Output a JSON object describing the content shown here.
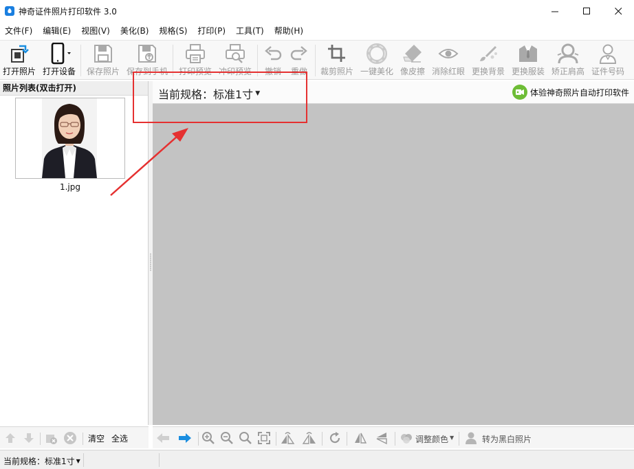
{
  "window": {
    "title": "神奇证件照片打印软件 3.0"
  },
  "menu": [
    {
      "label": "文件(F)"
    },
    {
      "label": "编辑(E)"
    },
    {
      "label": "视图(V)"
    },
    {
      "label": "美化(B)"
    },
    {
      "label": "规格(S)"
    },
    {
      "label": "打印(P)"
    },
    {
      "label": "工具(T)"
    },
    {
      "label": "帮助(H)"
    }
  ],
  "toolbar": {
    "open_photo": "打开照片",
    "open_device": "打开设备",
    "save_photo": "保存照片",
    "save_to_phone": "保存到手机",
    "print_preview": "打印预览",
    "develop_preview": "冲印预览",
    "undo": "撤销",
    "redo": "重做",
    "crop_photo": "裁剪照片",
    "one_click_beautify": "一键美化",
    "eraser": "像皮擦",
    "remove_red_eye": "消除红眼",
    "change_background": "更换背景",
    "change_clothes": "更换服装",
    "fix_shoulders": "矫正肩高",
    "id_number": "证件号码"
  },
  "photo_list": {
    "header": "照片列表(双击打开)",
    "items": [
      {
        "filename": "1.jpg"
      }
    ]
  },
  "main": {
    "spec_label": "当前规格：标准1寸",
    "promo": "体验神奇照片自动打印软件"
  },
  "left_bottom": {
    "clear": "清空",
    "select_all": "全选"
  },
  "bottom_toolbar": {
    "adjust_color": "调整颜色",
    "to_bw": "转为黑白照片"
  },
  "status": {
    "spec": "当前规格：标准1寸"
  },
  "colors": {
    "accent": "#1a7fe0",
    "highlight": "#e53030",
    "canvas": "#c3c3c3",
    "promo_badge": "#6ebd36"
  }
}
